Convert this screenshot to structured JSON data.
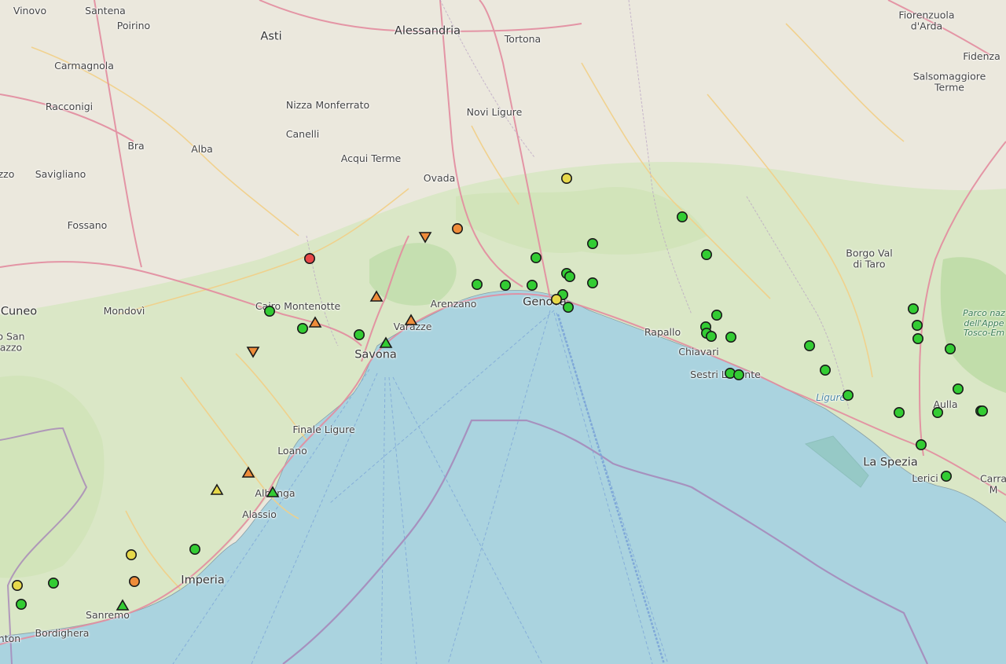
{
  "labels": [
    {
      "text": "Vinovo",
      "cls": ""
    },
    {
      "text": "Santena",
      "cls": ""
    },
    {
      "text": "Poirino",
      "cls": ""
    },
    {
      "text": "Asti",
      "cls": "big"
    },
    {
      "text": "Alessandria",
      "cls": "big"
    },
    {
      "text": "Tortona",
      "cls": ""
    },
    {
      "text": "Fiorenzuola\nd'Arda",
      "cls": ""
    },
    {
      "text": "Fidenza",
      "cls": ""
    },
    {
      "text": "Carmagnola",
      "cls": ""
    },
    {
      "text": "Salsomaggiore\nTerme",
      "cls": ""
    },
    {
      "text": "Racconigi",
      "cls": ""
    },
    {
      "text": "Nizza Monferrato",
      "cls": ""
    },
    {
      "text": "Novi Ligure",
      "cls": ""
    },
    {
      "text": "Canelli",
      "cls": ""
    },
    {
      "text": "Bra",
      "cls": ""
    },
    {
      "text": "Alba",
      "cls": ""
    },
    {
      "text": "Acqui Terme",
      "cls": ""
    },
    {
      "text": "zzo",
      "cls": ""
    },
    {
      "text": "Savigliano",
      "cls": ""
    },
    {
      "text": "Ovada",
      "cls": ""
    },
    {
      "text": "Fossano",
      "cls": ""
    },
    {
      "text": "Borgo Val\ndi Taro",
      "cls": ""
    },
    {
      "text": "Parco naz\ndell'Appe\nTosco-Em",
      "cls": "park"
    },
    {
      "text": "Cuneo",
      "cls": "big"
    },
    {
      "text": "Mondovì",
      "cls": ""
    },
    {
      "text": "Cairo Montenotte",
      "cls": ""
    },
    {
      "text": "Arenzano",
      "cls": ""
    },
    {
      "text": "Genova",
      "cls": "big"
    },
    {
      "text": "Varazze",
      "cls": ""
    },
    {
      "text": "Rapallo",
      "cls": ""
    },
    {
      "text": "Chiavari",
      "cls": ""
    },
    {
      "text": "Savona",
      "cls": "big"
    },
    {
      "text": "Sestri Levante",
      "cls": ""
    },
    {
      "text": "o San\nazzo",
      "cls": ""
    },
    {
      "text": "Ligure",
      "cls": "sea"
    },
    {
      "text": "Aulla",
      "cls": ""
    },
    {
      "text": "Finale Ligure",
      "cls": ""
    },
    {
      "text": "Loano",
      "cls": ""
    },
    {
      "text": "La Spezia",
      "cls": "big"
    },
    {
      "text": "Lerici",
      "cls": ""
    },
    {
      "text": "Carra\nM",
      "cls": ""
    },
    {
      "text": "Albenga",
      "cls": ""
    },
    {
      "text": "Alassio",
      "cls": ""
    },
    {
      "text": "Imperia",
      "cls": "big"
    },
    {
      "text": "Sanremo",
      "cls": ""
    },
    {
      "text": "Bordighera",
      "cls": ""
    },
    {
      "text": "nton",
      "cls": ""
    }
  ],
  "stations": [
    {
      "status": "green"
    },
    {
      "status": "green"
    },
    {
      "status": "green"
    },
    {
      "status": "green"
    },
    {
      "status": "green"
    },
    {
      "status": "green"
    },
    {
      "status": "green"
    },
    {
      "status": "green"
    },
    {
      "status": "green"
    },
    {
      "status": "green"
    },
    {
      "status": "green"
    },
    {
      "status": "green"
    },
    {
      "status": "green"
    },
    {
      "status": "green"
    },
    {
      "status": "green"
    },
    {
      "status": "green"
    },
    {
      "status": "green"
    },
    {
      "status": "green"
    },
    {
      "status": "green"
    },
    {
      "status": "green"
    },
    {
      "status": "green"
    },
    {
      "status": "green"
    },
    {
      "status": "green"
    },
    {
      "status": "green"
    },
    {
      "status": "green"
    },
    {
      "status": "green"
    },
    {
      "status": "green"
    },
    {
      "status": "green"
    },
    {
      "status": "green"
    },
    {
      "status": "green"
    },
    {
      "status": "green"
    },
    {
      "status": "green"
    },
    {
      "status": "green"
    },
    {
      "status": "green"
    },
    {
      "status": "green"
    },
    {
      "status": "green"
    },
    {
      "status": "green"
    },
    {
      "status": "green"
    },
    {
      "status": "green"
    },
    {
      "status": "yellow"
    },
    {
      "status": "yellow"
    },
    {
      "status": "yellow"
    },
    {
      "status": "yellow"
    },
    {
      "status": "orange"
    },
    {
      "status": "orange"
    },
    {
      "status": "red"
    },
    {
      "status": "up-orange"
    },
    {
      "status": "up-orange"
    },
    {
      "status": "up-orange"
    },
    {
      "status": "up-orange"
    },
    {
      "status": "up-green"
    },
    {
      "status": "up-green"
    },
    {
      "status": "up-green"
    },
    {
      "status": "up-yellow"
    },
    {
      "status": "down-orange"
    },
    {
      "status": "down-orange"
    }
  ],
  "colors": {
    "land": "#e9e5dc",
    "sea": "#aad3df",
    "forest": "#c8e3a8",
    "park": "#b8d9a0",
    "road_major": "#e892a2",
    "road_secondary": "#f7d28a",
    "boundary": "#a685b8",
    "green": "#33cc33",
    "yellow": "#e6d84a",
    "orange": "#ee8c3a",
    "red": "#e84848",
    "outline": "#1a1a1a"
  }
}
